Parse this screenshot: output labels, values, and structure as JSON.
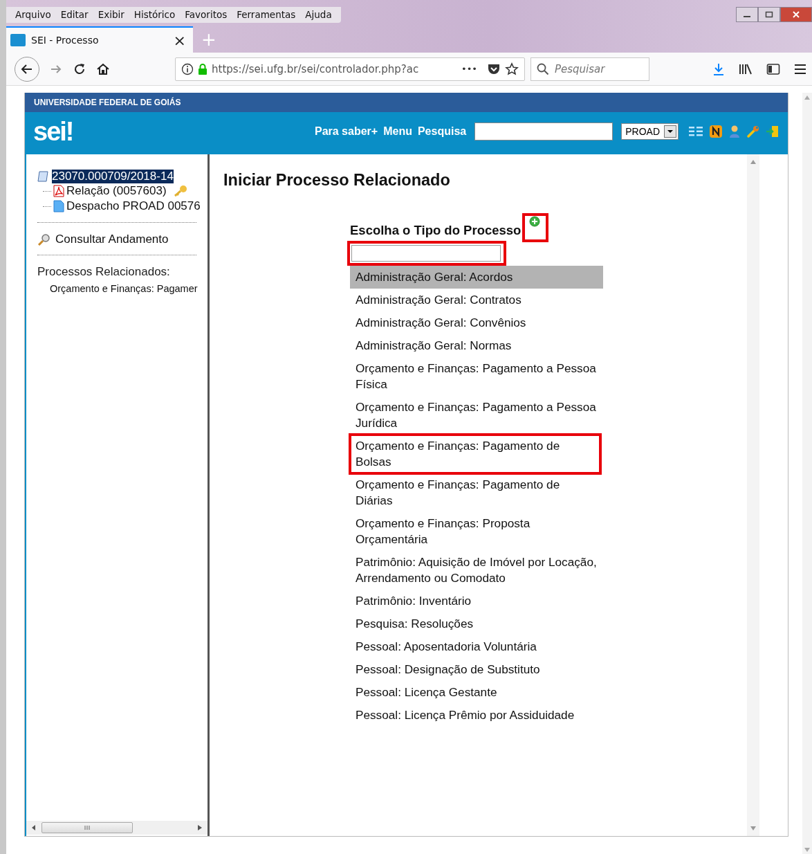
{
  "menu_bar": [
    "Arquivo",
    "Editar",
    "Exibir",
    "Histórico",
    "Favoritos",
    "Ferramentas",
    "Ajuda"
  ],
  "tabs": [
    {
      "title": "SEI - Processo",
      "close": "×",
      "selected": true
    }
  ],
  "new_tab": "+",
  "address_bar": {
    "url": "https://sei.ufg.br/sei/controlador.php?ac",
    "dots": "•••"
  },
  "browser_search": {
    "placeholder": "Pesquisar"
  },
  "header": {
    "institution": "UNIVERSIDADE FEDERAL DE GOIÁS",
    "logo": "sei!",
    "links": [
      "Para saber+",
      "Menu",
      "Pesquisa"
    ],
    "unit": "PROAD"
  },
  "tree": {
    "label": "23070.000709/2018-14",
    "selected": true,
    "children": [
      {
        "label": "Relação (0057603)",
        "kind": "pdf",
        "signed": true
      },
      {
        "label": "Despacho PROAD 00576",
        "kind": "doc",
        "signed": false
      }
    ]
  },
  "consult": "Consultar Andamento",
  "related": {
    "title": "Processos Relacionados:",
    "items": [
      "Orçamento e Finanças: Pagamer"
    ]
  },
  "page_title": "Iniciar Processo Relacionado",
  "chooser": {
    "label": "Escolha o Tipo do Processo",
    "add_highlighted": true,
    "filter_highlighted": true
  },
  "types": [
    {
      "label": "Administração Geral: Acordos",
      "selected": true,
      "highlighted": false
    },
    {
      "label": "Administração Geral: Contratos",
      "selected": false,
      "highlighted": false
    },
    {
      "label": "Administração Geral: Convênios",
      "selected": false,
      "highlighted": false
    },
    {
      "label": "Administração Geral: Normas",
      "selected": false,
      "highlighted": false
    },
    {
      "label": "Orçamento e Finanças: Pagamento a Pessoa Física",
      "selected": false,
      "highlighted": false
    },
    {
      "label": "Orçamento e Finanças: Pagamento a Pessoa Jurídica",
      "selected": false,
      "highlighted": false
    },
    {
      "label": "Orçamento e Finanças: Pagamento de Bolsas",
      "selected": false,
      "highlighted": true
    },
    {
      "label": "Orçamento e Finanças: Pagamento de Diárias",
      "selected": false,
      "highlighted": false
    },
    {
      "label": "Orçamento e Finanças: Proposta Orçamentária",
      "selected": false,
      "highlighted": false
    },
    {
      "label": "Patrimônio: Aquisição de Imóvel por Locação, Arrendamento ou Comodato",
      "selected": false,
      "highlighted": false
    },
    {
      "label": "Patrimônio: Inventário",
      "selected": false,
      "highlighted": false
    },
    {
      "label": "Pesquisa: Resoluções",
      "selected": false,
      "highlighted": false
    },
    {
      "label": "Pessoal: Aposentadoria Voluntária",
      "selected": false,
      "highlighted": false
    },
    {
      "label": "Pessoal: Designação de Substituto",
      "selected": false,
      "highlighted": false
    },
    {
      "label": "Pessoal: Licença Gestante",
      "selected": false,
      "highlighted": false
    },
    {
      "label": "Pessoal: Licença Prêmio por Assiduidade",
      "selected": false,
      "highlighted": false
    }
  ]
}
